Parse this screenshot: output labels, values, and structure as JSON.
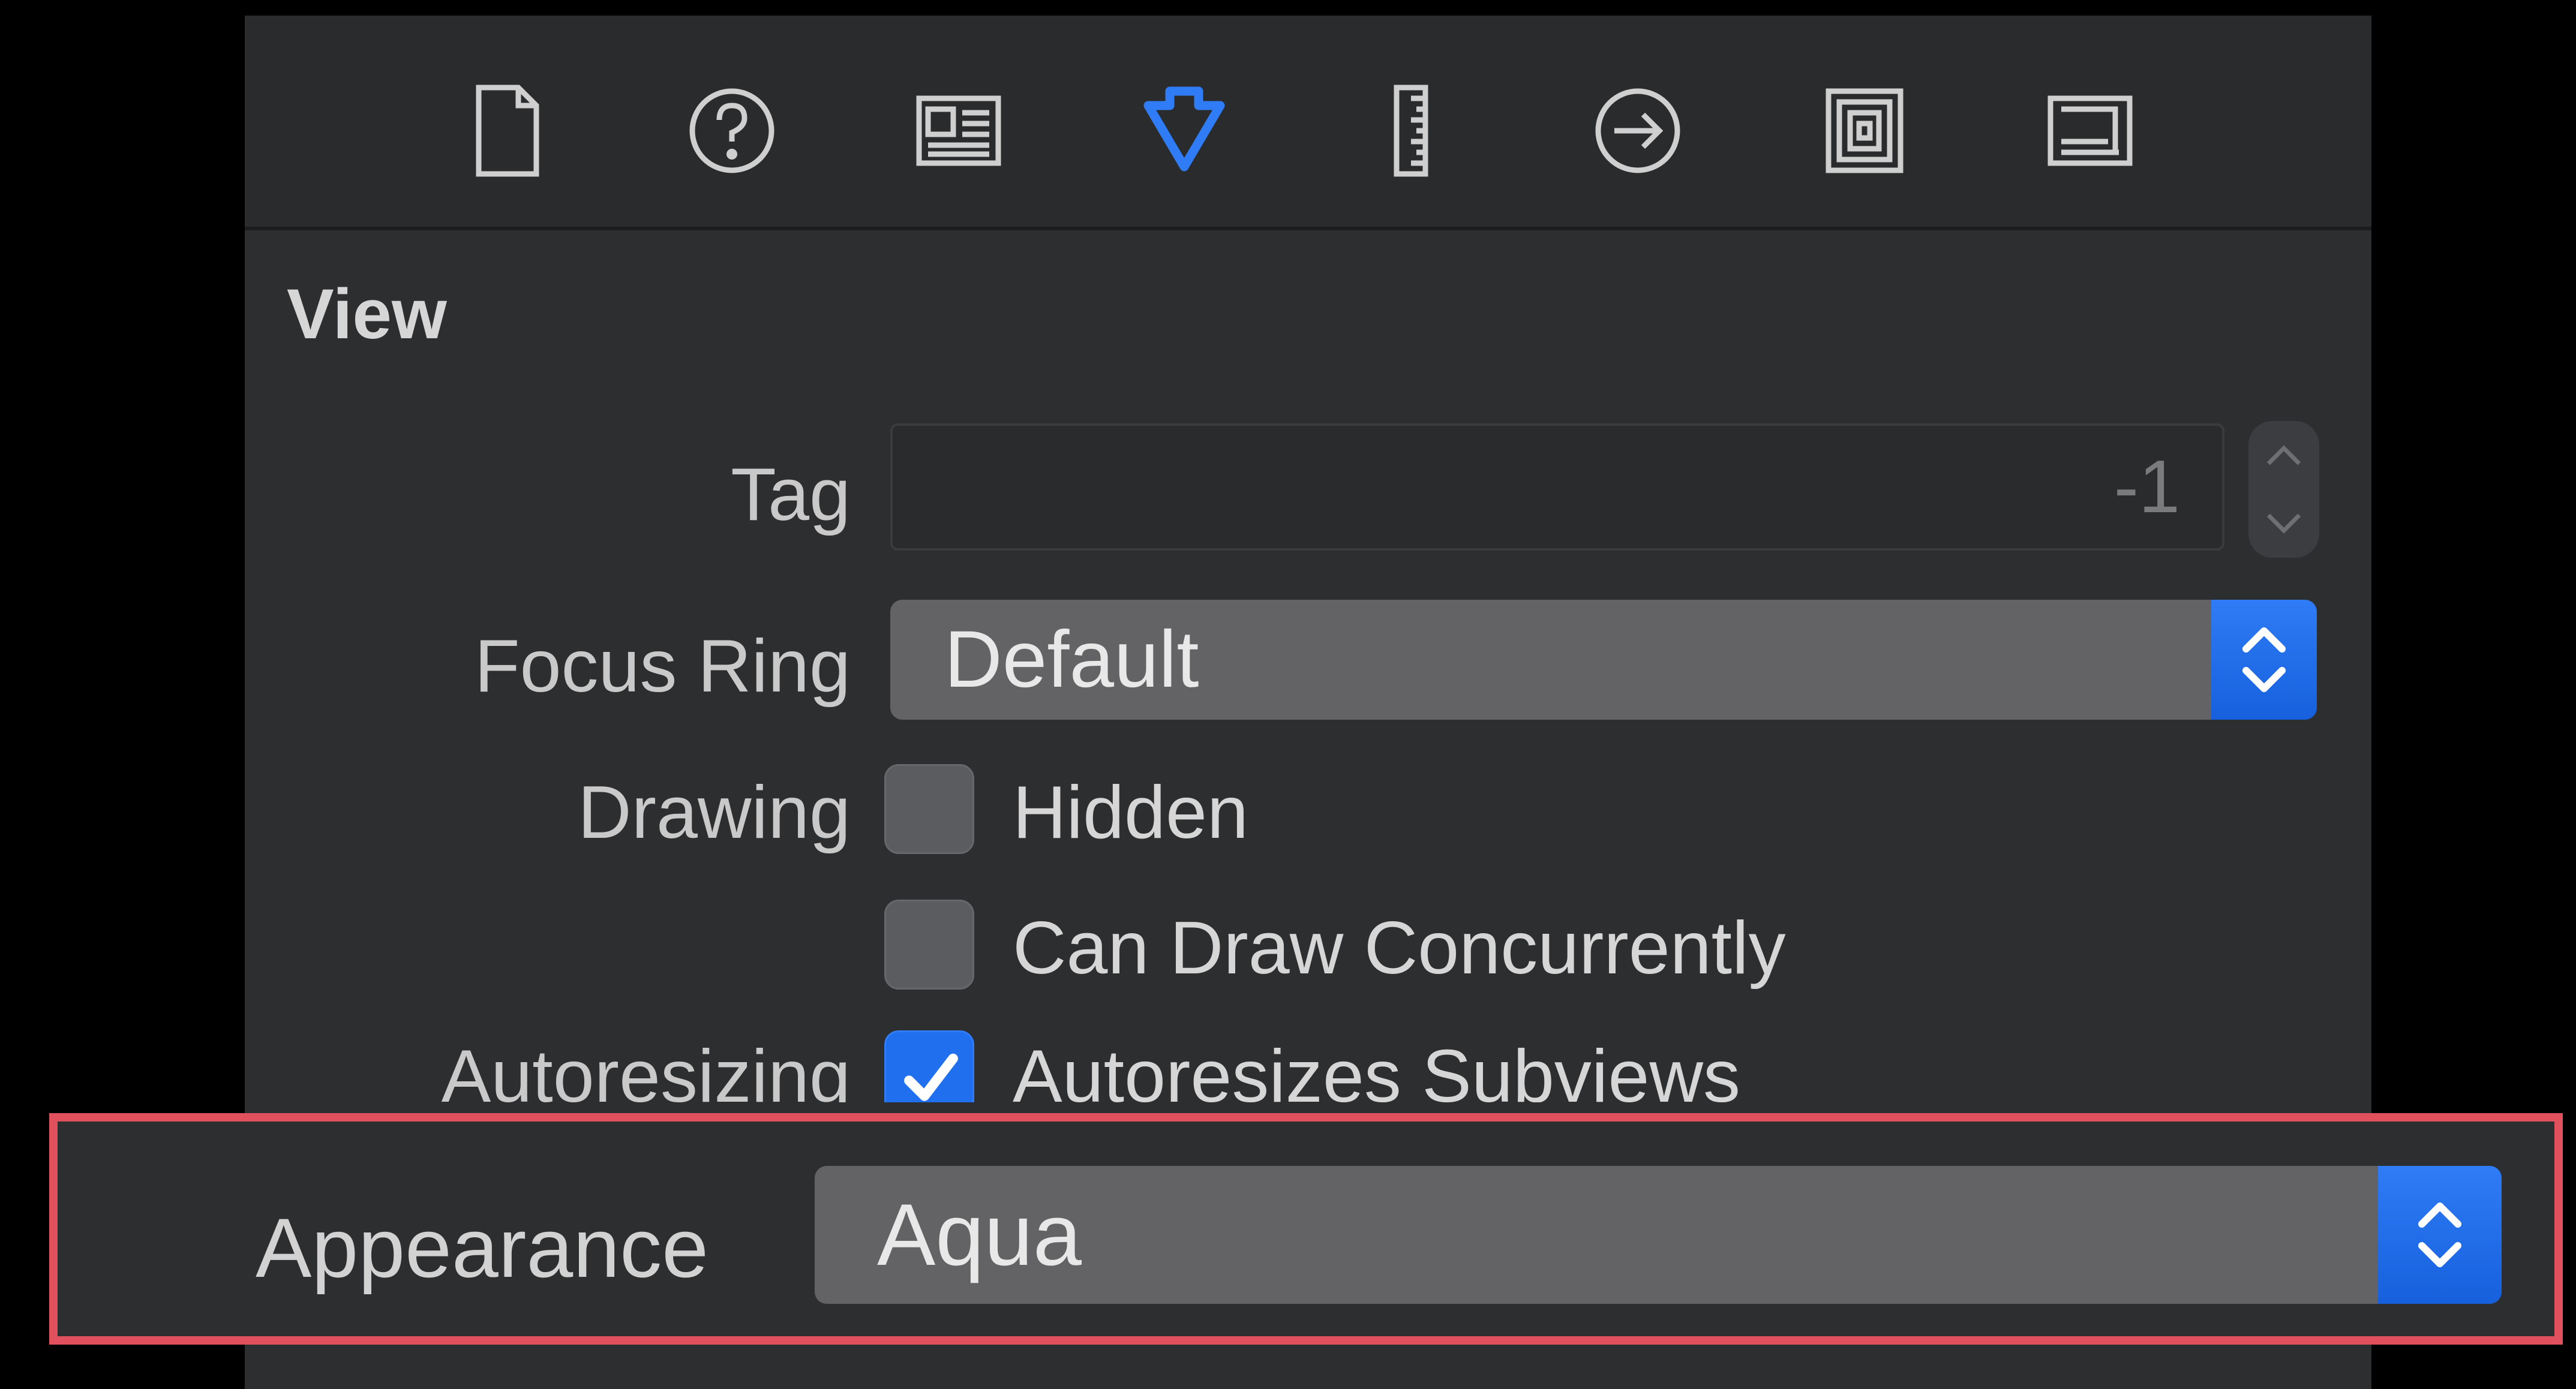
{
  "toolbar": {
    "icons": [
      {
        "name": "file-inspector-icon",
        "selected": false
      },
      {
        "name": "quick-help-icon",
        "selected": false
      },
      {
        "name": "identity-inspector-icon",
        "selected": false
      },
      {
        "name": "attributes-inspector-icon",
        "selected": true
      },
      {
        "name": "size-inspector-icon",
        "selected": false
      },
      {
        "name": "connections-inspector-icon",
        "selected": false
      },
      {
        "name": "bindings-inspector-icon",
        "selected": false
      },
      {
        "name": "view-effects-inspector-icon",
        "selected": false
      }
    ],
    "accent_color": "#2f7cf6"
  },
  "section": {
    "title": "View"
  },
  "tag": {
    "label": "Tag",
    "value": "-1"
  },
  "focus_ring": {
    "label": "Focus Ring",
    "value": "Default"
  },
  "drawing": {
    "label": "Drawing",
    "hidden": {
      "label": "Hidden",
      "checked": false
    },
    "concurrent": {
      "label": "Can Draw Concurrently",
      "checked": false
    }
  },
  "autoresizing": {
    "label": "Autoresizing",
    "subviews": {
      "label": "Autoresizes Subviews",
      "checked": true
    }
  },
  "appearance": {
    "label": "Appearance",
    "value": "Aqua"
  },
  "highlight_color": "#e0505d"
}
